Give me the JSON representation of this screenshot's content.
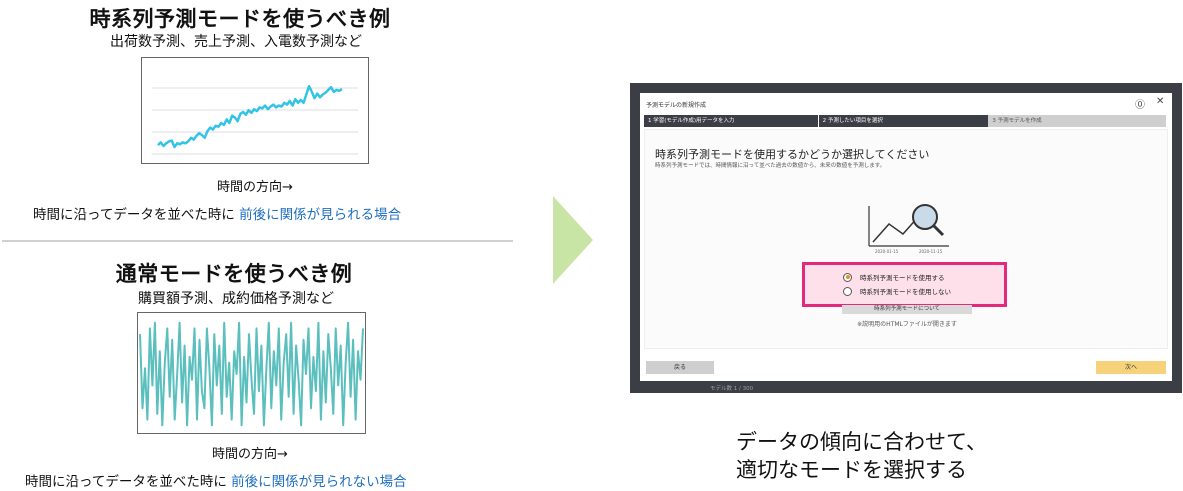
{
  "left": {
    "timeseries": {
      "title": "時系列予測モードを使うべき例",
      "examples": "出荷数予測、売上予測、入電数予測など",
      "axis_label": "時間の方向→",
      "note_prefix": "時間に沿ってデータを並べた時に",
      "note_highlight": "前後に関係が見られる場合",
      "line_color": "#33c3e6",
      "values": [
        0.14,
        0.17,
        0.13,
        0.16,
        0.18,
        0.19,
        0.12,
        0.16,
        0.15,
        0.17,
        0.16,
        0.18,
        0.22,
        0.2,
        0.24,
        0.27,
        0.25,
        0.22,
        0.29,
        0.33,
        0.31,
        0.35,
        0.34,
        0.38,
        0.36,
        0.42,
        0.38,
        0.46,
        0.44,
        0.4,
        0.48,
        0.5,
        0.47,
        0.52,
        0.49,
        0.53,
        0.51,
        0.55,
        0.54,
        0.57,
        0.53,
        0.56,
        0.58,
        0.55,
        0.57,
        0.56,
        0.6,
        0.58,
        0.62,
        0.57,
        0.64,
        0.6,
        0.63,
        0.6,
        0.69,
        0.78,
        0.72,
        0.65,
        0.7,
        0.66,
        0.69,
        0.71,
        0.74,
        0.77,
        0.72,
        0.74,
        0.73,
        0.75
      ]
    },
    "normal": {
      "title": "通常モードを使うべき例",
      "examples": "購買額予測、成約価格予測など",
      "axis_label": "時間の方向→",
      "note_prefix": "時間に沿ってデータを並べた時に",
      "note_highlight": "前後に関係が見られない場合",
      "line_color": "#5bbfbe",
      "values": [
        0.85,
        0.2,
        0.55,
        0.1,
        0.9,
        0.4,
        0.95,
        0.15,
        0.7,
        0.05,
        0.6,
        0.9,
        0.3,
        0.8,
        0.1,
        0.5,
        0.95,
        0.25,
        0.75,
        0.05,
        0.65,
        0.45,
        0.9,
        0.1,
        0.8,
        0.35,
        0.2,
        0.9,
        0.55,
        0.05,
        0.85,
        0.4,
        0.75,
        0.15,
        0.95,
        0.3,
        0.6,
        0.1,
        0.7,
        0.5,
        0.95,
        0.05,
        0.65,
        0.25,
        0.85,
        0.45,
        0.15,
        0.9,
        0.35,
        0.75,
        0.05,
        0.55,
        0.95,
        0.2,
        0.7,
        0.4,
        0.9,
        0.1,
        0.6,
        0.85,
        0.3,
        0.95,
        0.15,
        0.75,
        0.45,
        0.05,
        0.8,
        0.5,
        0.9,
        0.2,
        0.65,
        0.35,
        0.95,
        0.1,
        0.7,
        0.25,
        0.85,
        0.55,
        0.15,
        0.9,
        0.4,
        0.75,
        0.05,
        0.6,
        0.95,
        0.3,
        0.8,
        0.1,
        0.7,
        0.45,
        0.9
      ]
    }
  },
  "dialog": {
    "title": "予測モデルの新規作成",
    "help_icon": "help-circle-icon",
    "close_icon": "close-icon",
    "steps": [
      {
        "label": "1 学習(モデル作成)用データを入力"
      },
      {
        "label": "2 予測したい項目を選択"
      },
      {
        "label": "3 予測モデルを作成"
      }
    ],
    "question": "時系列予測モードを使用するかどうか選択してください",
    "description": "時系列予測モードでは、時間情報に沿って並べた過去の数値から、未来の数値を予測します。",
    "illustration_dates": [
      "2020-01-15",
      "2020-11-15"
    ],
    "options": [
      {
        "label": "時系列予測モードを使用する",
        "selected": true
      },
      {
        "label": "時系列予測モードを使用しない",
        "selected": false
      }
    ],
    "about_button": "時系列予測モードについて",
    "html_note": "※説明用のHTMLファイルが開きます",
    "back_button": "戻る",
    "next_button": "次へ",
    "bottom_text": "モデル数 1 / 300"
  },
  "caption": {
    "line1": "データの傾向に合わせて、",
    "line2": "適切なモードを選択する"
  },
  "colors": {
    "highlight_text": "#1f6fc2",
    "selection_border": "#e2297b",
    "arrow": "#c9e5a6"
  }
}
